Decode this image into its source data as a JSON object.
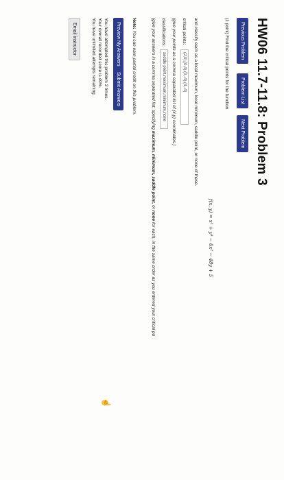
{
  "header": {
    "title": "HW06 11.7-11.8: Problem 3"
  },
  "nav": {
    "previous_label": "Previous Problem",
    "list_label": "Problem List",
    "next_label": "Next Problem"
  },
  "problem": {
    "points_text": "(1 point) Find the critical points for the function",
    "function_text": "f(x, y) = x³ + y³ − 6x² − 48y + 5",
    "classify_text": "and classify each as a local maximum, local minimum, saddle point, or none of these.",
    "critical_label": "critical points:",
    "critical_value": "(2,0),(0,4),(0,-4),(4,-4)",
    "critical_hint": "(give your points as a comma separated list of (x,y) coordinates.)",
    "class_label": "classifications:",
    "class_value": "saddle point,maximum,minimum,none",
    "class_hint_pre": "(give your answers in a comma separated list, specifying ",
    "class_hint_terms": "maximum, minimum, saddle point,",
    "class_hint_or": " or ",
    "class_hint_none": "none",
    "class_hint_post": " for each, in the same order as you entered your critical po"
  },
  "note": {
    "label": "Note:",
    "text": " You can earn partial credit on this problem."
  },
  "actions": {
    "preview_label": "Preview My Answers",
    "submit_label": "Submit Answers"
  },
  "status": {
    "attempts": "You have attempted this problem 2 times.",
    "score": "Your overall recorded score is 40%.",
    "remaining": "You have unlimited attempts remaining."
  },
  "footer": {
    "email_label": "Email instructor"
  },
  "colors": {
    "button": "#2c3a8e",
    "background": "#fdfdfc"
  }
}
